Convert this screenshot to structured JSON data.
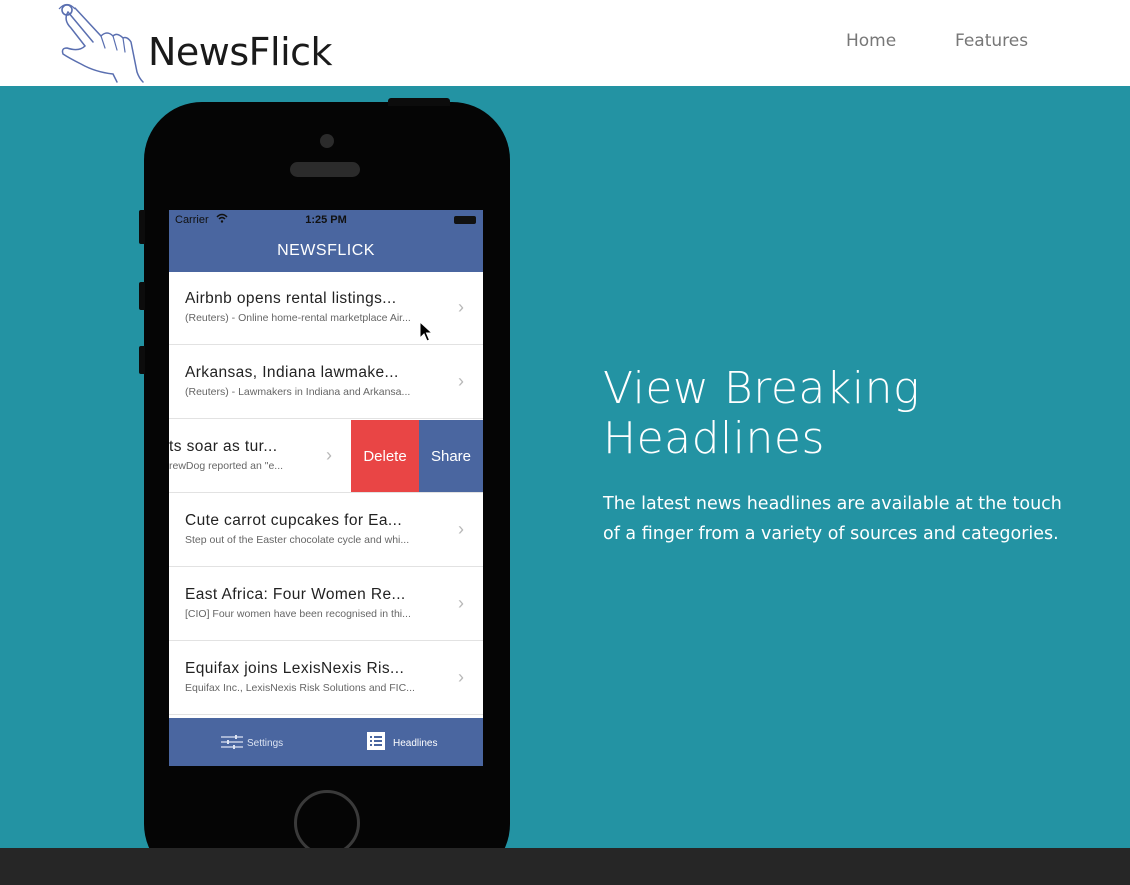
{
  "header": {
    "brand": "NewsFlick",
    "nav": [
      {
        "label": "Home"
      },
      {
        "label": "Features"
      }
    ]
  },
  "hero": {
    "title_line1": "View Breaking",
    "title_line2": "Headlines",
    "text_line1": "The latest news headlines are available at the touch",
    "text_line2": "of a finger from a variety of sources and categories.",
    "background_color": "#2393a3"
  },
  "phone": {
    "status": {
      "carrier": "Carrier",
      "time": "1:25 PM",
      "wifi_icon": "wifi-icon",
      "battery_icon": "battery-icon"
    },
    "app_title": "NEWSFLICK",
    "accent_color": "#4a66a0",
    "headlines": [
      {
        "title": "Airbnb opens rental listings...",
        "subtitle": "(Reuters) - Online home-rental marketplace Air..."
      },
      {
        "title": "Arkansas, Indiana lawmake...",
        "subtitle": "(Reuters) - Lawmakers in Indiana and Arkansa..."
      },
      {
        "title": "ts soar as tur...",
        "subtitle": "rewDog reported an \"e..."
      },
      {
        "title": "Cute carrot cupcakes for Ea...",
        "subtitle": "Step out of the Easter chocolate cycle and whi..."
      },
      {
        "title": "East Africa: Four Women Re...",
        "subtitle": "[CIO] Four women have been recognised in thi..."
      },
      {
        "title": "Equifax joins LexisNexis Ris...",
        "subtitle": "Equifax Inc., LexisNexis Risk Solutions and FIC..."
      }
    ],
    "swipe_actions": {
      "delete": "Delete",
      "share": "Share",
      "delete_color": "#e94545"
    },
    "tabs": [
      {
        "label": "Settings",
        "icon": "sliders-icon"
      },
      {
        "label": "Headlines",
        "icon": "list-icon"
      }
    ]
  }
}
